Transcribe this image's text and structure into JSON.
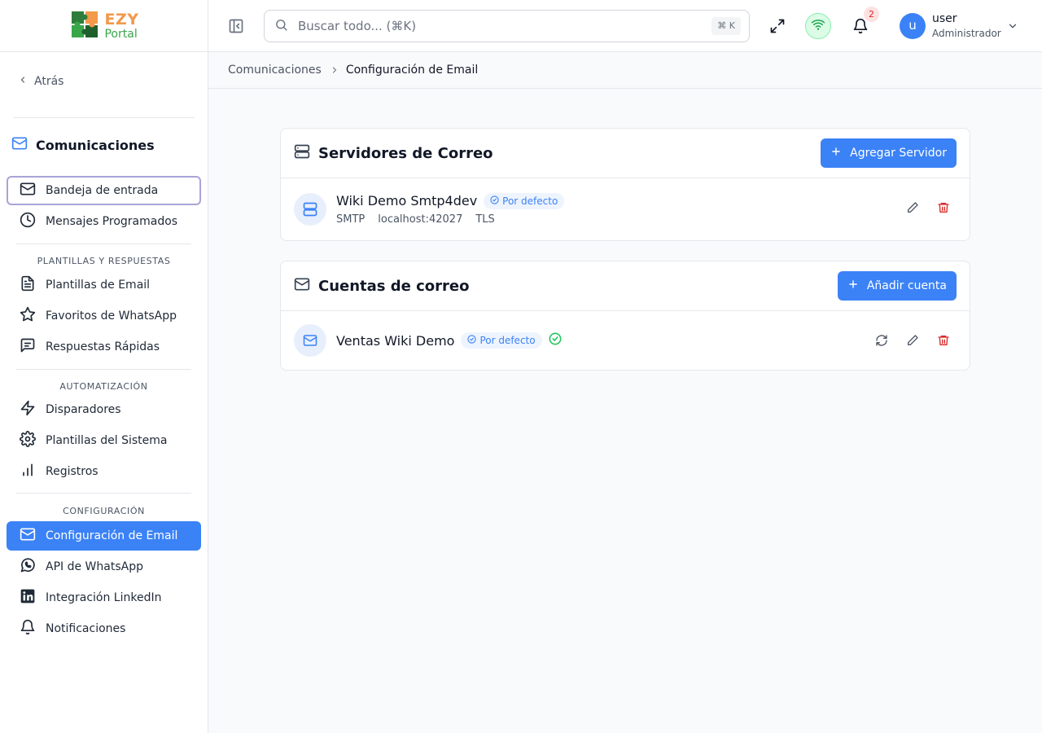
{
  "logo": {
    "name_part1": "EZY",
    "name_part2": "Portal"
  },
  "sidebar": {
    "back_label": "Atrás",
    "section_title": "Comunicaciones",
    "items_top": [
      {
        "label": "Bandeja de entrada",
        "icon": "mail-icon"
      },
      {
        "label": "Mensajes Programados",
        "icon": "clock-icon"
      }
    ],
    "groups": [
      {
        "label": "PLANTILLAS Y RESPUESTAS",
        "items": [
          {
            "label": "Plantillas de Email",
            "icon": "file-text-icon"
          },
          {
            "label": "Favoritos de WhatsApp",
            "icon": "star-icon"
          },
          {
            "label": "Respuestas Rápidas",
            "icon": "message-square-icon"
          }
        ]
      },
      {
        "label": "AUTOMATIZACIÓN",
        "items": [
          {
            "label": "Disparadores",
            "icon": "zap-icon"
          },
          {
            "label": "Plantillas del Sistema",
            "icon": "gear-icon"
          },
          {
            "label": "Registros",
            "icon": "bar-chart-icon"
          }
        ]
      },
      {
        "label": "CONFIGURACIÓN",
        "items": [
          {
            "label": "Configuración de Email",
            "icon": "mail-icon",
            "active": true
          },
          {
            "label": "API de WhatsApp",
            "icon": "whatsapp-icon"
          },
          {
            "label": "Integración LinkedIn",
            "icon": "linkedin-icon"
          },
          {
            "label": "Notificaciones",
            "icon": "bell-icon"
          }
        ]
      }
    ]
  },
  "header": {
    "search_placeholder": "Buscar todo... (⌘K)",
    "search_shortcut": "⌘ K",
    "notification_count": "2",
    "user": {
      "initial": "u",
      "name": "user",
      "role": "Administrador"
    }
  },
  "breadcrumb": {
    "parent": "Comunicaciones",
    "current": "Configuración de Email"
  },
  "servers_card": {
    "title": "Servidores de Correo",
    "add_button": "Agregar Servidor",
    "servers": [
      {
        "name": "Wiki Demo Smtp4dev",
        "badge": "Por defecto",
        "protocol": "SMTP",
        "host": "localhost:42027",
        "security": "TLS"
      }
    ]
  },
  "accounts_card": {
    "title": "Cuentas de correo",
    "add_button": "Añadir cuenta",
    "accounts": [
      {
        "name": "Ventas Wiki Demo",
        "badge": "Por defecto",
        "verified": true
      }
    ]
  },
  "colors": {
    "accent": "#3b82f6",
    "danger": "#dc2626",
    "success": "#22c55e",
    "logo_orange": "#f2994a",
    "logo_green": "#3aa64a"
  }
}
